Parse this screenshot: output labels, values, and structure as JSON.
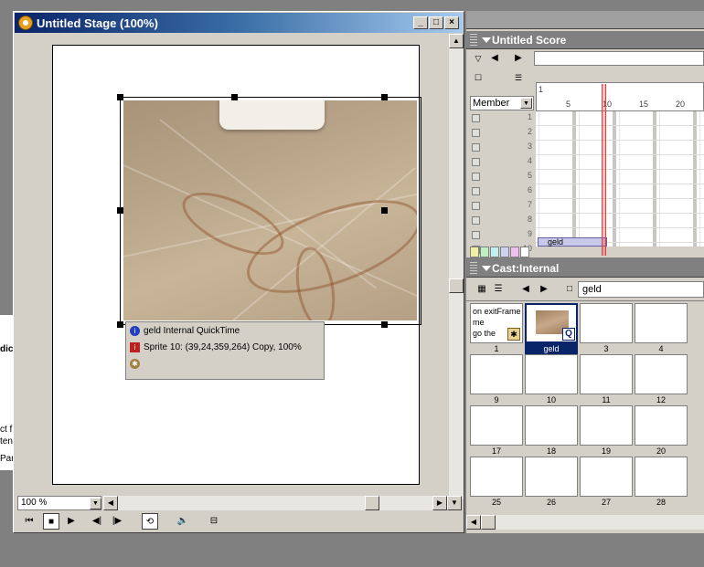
{
  "stage": {
    "title": "Untitled Stage (100%)",
    "zoom_value": "100 %",
    "overlay": {
      "line1": "geld Internal QuickTime",
      "line2": "Sprite 10: (39,24,359,264) Copy, 100%"
    }
  },
  "score": {
    "title": "Untitled Score",
    "member_select": "Member",
    "frame_numbers": [
      "1",
      "5",
      "10",
      "15",
      "20"
    ],
    "channels": [
      "1",
      "2",
      "3",
      "4",
      "5",
      "6",
      "7",
      "8",
      "9",
      "10"
    ],
    "sprite_label": "geld"
  },
  "cast": {
    "title": "Cast:Internal",
    "name_field": "geld",
    "script_text": [
      "on exitFrame",
      "me",
      "go the"
    ],
    "members": [
      "1",
      "geld",
      "3",
      "4",
      "9",
      "10",
      "11",
      "12",
      "17",
      "18",
      "19",
      "20",
      "25",
      "26",
      "27",
      "28"
    ]
  },
  "background": {
    "fragments": [
      "dic",
      "ct f",
      "ten",
      "Par"
    ]
  },
  "colors": {
    "title_gradient_start": "#0a246a",
    "panel_header": "#808080",
    "face": "#d4d0c8",
    "playhead": "#e04040"
  }
}
